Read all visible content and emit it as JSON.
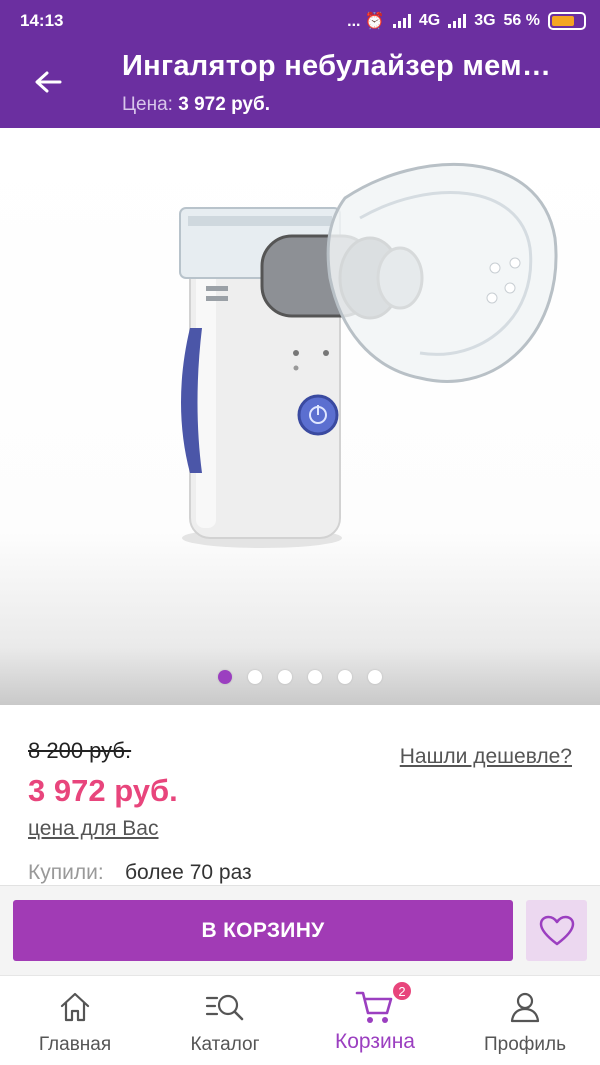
{
  "status_bar": {
    "time": "14:13",
    "indicators": "... ⏰",
    "net1": "4G",
    "net2": "3G",
    "battery": "56 %"
  },
  "header": {
    "title": "Ингалятор небулайзер мем…",
    "price_label": "Цена:",
    "price_value": "3 972 руб."
  },
  "gallery": {
    "slide_count": 6,
    "active_slide": 1
  },
  "pricing": {
    "old_price": "8 200 руб.",
    "found_cheaper_link": "Нашли дешевле?",
    "current_price": "3 972 руб.",
    "price_note": "цена для Вас",
    "bought_label": "Купили:",
    "bought_value": "более 70 раз"
  },
  "actions": {
    "add_to_cart": "В КОРЗИНУ"
  },
  "bottom_nav": {
    "items": [
      {
        "label": "Главная",
        "icon": "home-icon"
      },
      {
        "label": "Каталог",
        "icon": "catalog-search-icon"
      },
      {
        "label": "Корзина",
        "icon": "cart-icon",
        "badge": "2",
        "active": true
      },
      {
        "label": "Профиль",
        "icon": "profile-icon"
      }
    ]
  },
  "colors": {
    "brand": "#6b2fa0",
    "accent": "#a13bb5",
    "price": "#e8457c"
  }
}
